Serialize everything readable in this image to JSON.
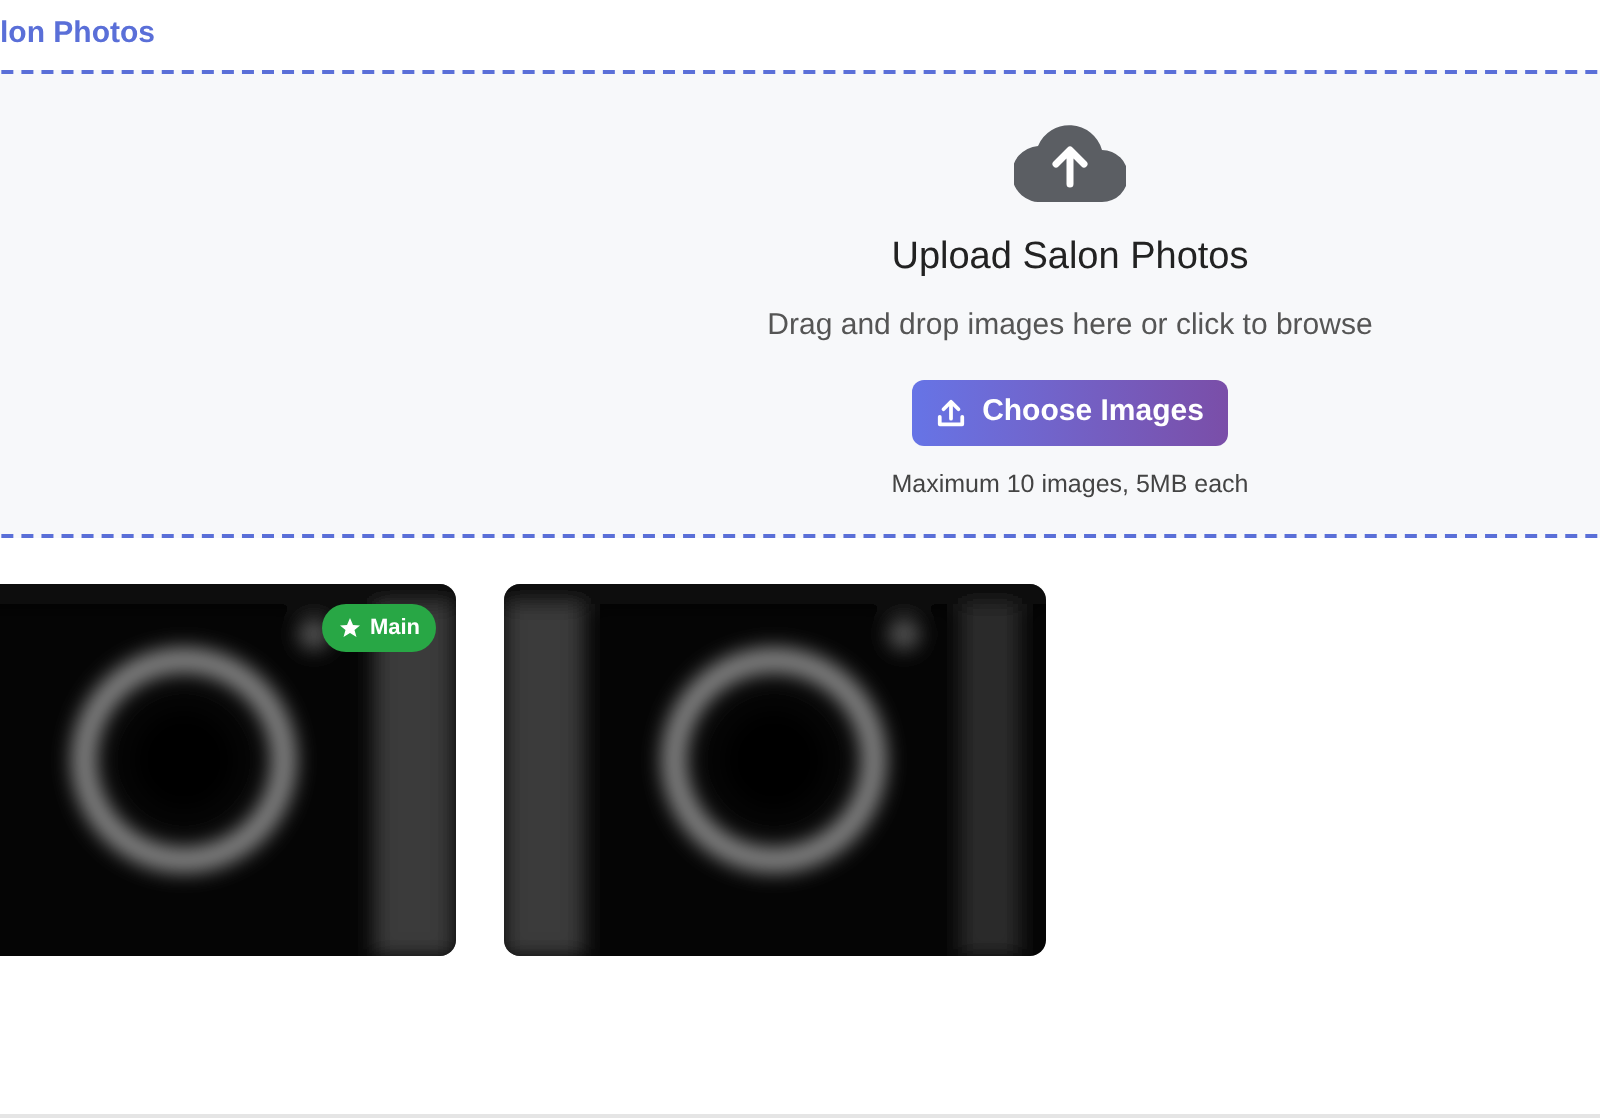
{
  "heading": "lon Photos",
  "upload": {
    "title": "Upload Salon Photos",
    "subtitle": "Drag and drop images here or click to browse",
    "button": "Choose Images",
    "note": "Maximum 10 images, 5MB each"
  },
  "main_label": "Main",
  "photos": [
    {
      "kind": "picture",
      "main": true
    },
    {
      "kind": "picture",
      "main": false
    }
  ]
}
